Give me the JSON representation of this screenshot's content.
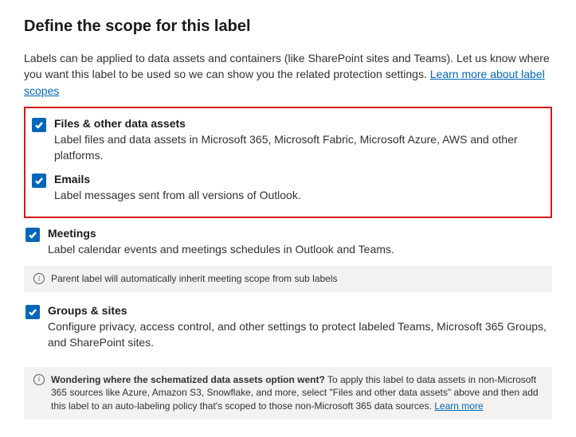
{
  "heading": "Define the scope for this label",
  "intro": {
    "text": "Labels can be applied to data assets and containers (like SharePoint sites and Teams). Let us know where you want this label to be used so we can show you the related protection settings. ",
    "link": "Learn more about label scopes"
  },
  "scopes": {
    "files": {
      "title": "Files & other data assets",
      "desc": "Label files and data assets in Microsoft 365, Microsoft Fabric, Microsoft Azure, AWS and other platforms."
    },
    "emails": {
      "title": "Emails",
      "desc": "Label messages sent from all versions of Outlook."
    },
    "meetings": {
      "title": "Meetings",
      "desc": "Label calendar events and meetings schedules in Outlook and Teams."
    },
    "groups": {
      "title": "Groups & sites",
      "desc": "Configure privacy, access control, and other settings to protect labeled Teams, Microsoft 365 Groups, and SharePoint sites."
    }
  },
  "meetings_note": "Parent label will automatically inherit meeting scope from sub labels",
  "schematized_note": {
    "strong": "Wondering where the schematized data assets option went?",
    "rest": " To apply this label to data assets in non-Microsoft 365 sources like Azure, Amazon S3, Snowflake, and more, select \"Files and other data assets\" above and then add this label to an auto-labeling policy that's scoped to those non-Microsoft 365 data sources. ",
    "link": "Learn more"
  }
}
